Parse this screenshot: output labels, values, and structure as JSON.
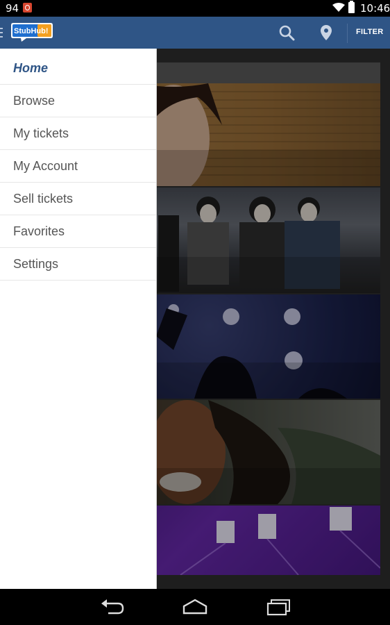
{
  "status_bar": {
    "notification_count": "94",
    "time": "10:46",
    "icons": [
      "notification-icon",
      "wifi-icon",
      "battery-icon"
    ]
  },
  "app_bar": {
    "logo_text": "StubHub!",
    "filter_label": "FILTER",
    "icons": [
      "menu-icon",
      "search-icon",
      "location-pin-icon"
    ],
    "colors": {
      "bar": "#2f5586",
      "logo_blue": "#1f6fcf",
      "logo_orange": "#f4a020"
    }
  },
  "drawer": {
    "items": [
      {
        "label": "Home",
        "active": true
      },
      {
        "label": "Browse"
      },
      {
        "label": "My tickets"
      },
      {
        "label": "My Account"
      },
      {
        "label": "Sell tickets"
      },
      {
        "label": "Favorites"
      },
      {
        "label": "Settings"
      }
    ]
  },
  "content": {
    "tiles": [
      {
        "theme": "singer-brick-wall"
      },
      {
        "theme": "rock-band-group"
      },
      {
        "theme": "concert-crowd-lights"
      },
      {
        "theme": "reggae-artist-closeup"
      },
      {
        "theme": "purple-stage-lights"
      }
    ]
  },
  "nav_bar": {
    "icons": [
      "back-icon",
      "home-icon",
      "recent-apps-icon"
    ]
  }
}
